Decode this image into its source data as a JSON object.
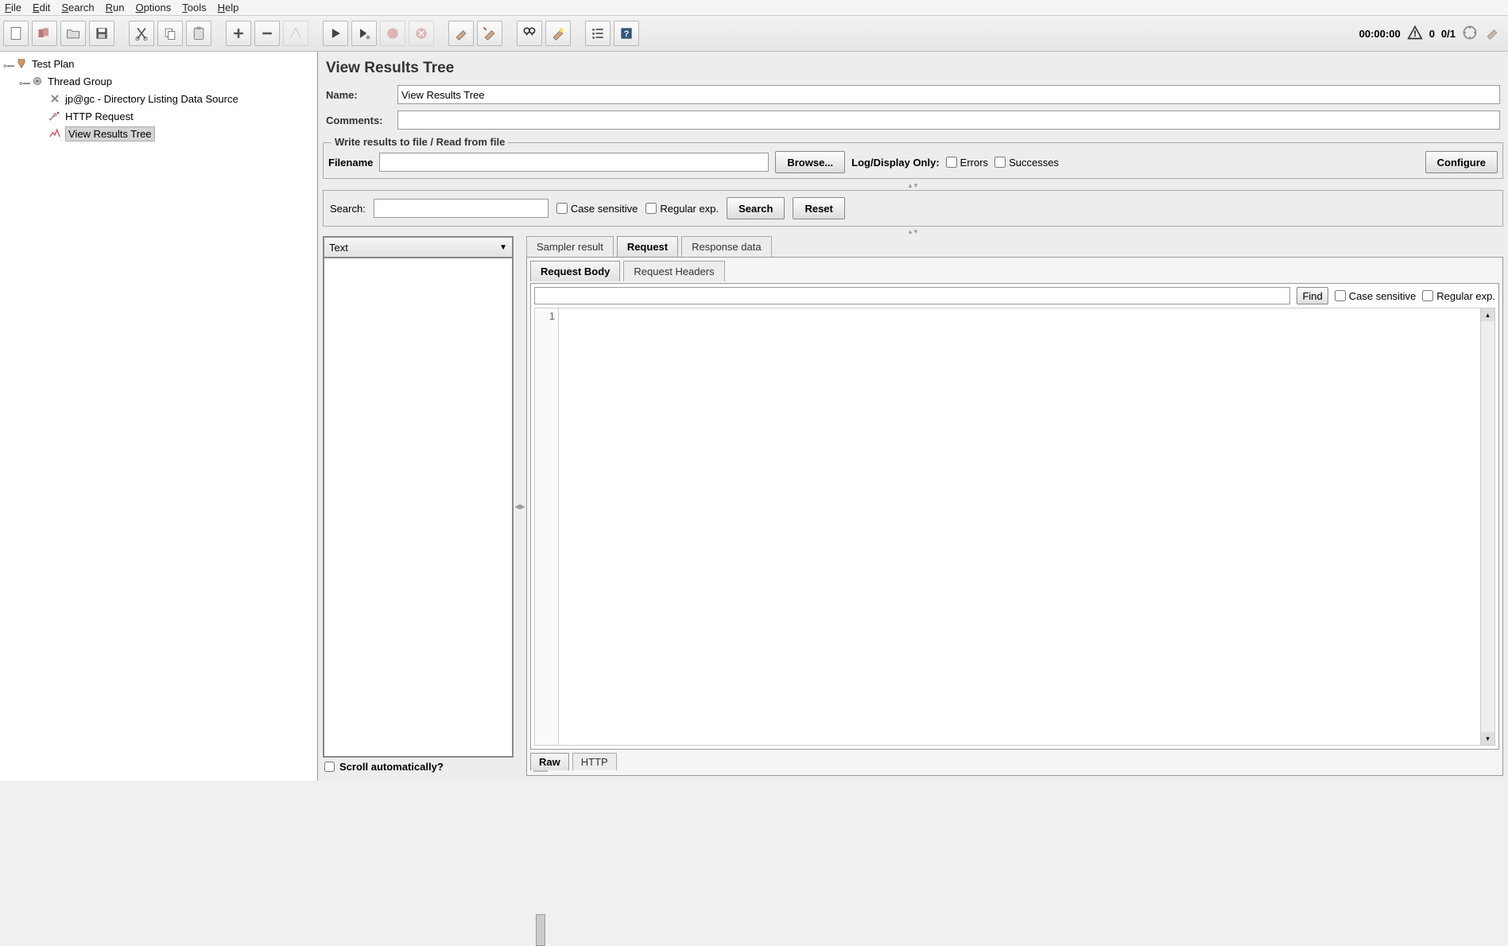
{
  "menu": [
    "File",
    "Edit",
    "Search",
    "Run",
    "Options",
    "Tools",
    "Help"
  ],
  "toolbar_right": {
    "time": "00:00:00",
    "warn": "0",
    "threads": "0/1"
  },
  "tree": {
    "root": "Test Plan",
    "group": "Thread Group",
    "items": [
      "jp@gc - Directory Listing Data Source",
      "HTTP Request",
      "View Results Tree"
    ],
    "selected_index": 2
  },
  "panel": {
    "title": "View Results Tree",
    "name_label": "Name:",
    "name_value": "View Results Tree",
    "comments_label": "Comments:",
    "comments_value": "",
    "file_legend": "Write results to file / Read from file",
    "filename_label": "Filename",
    "filename_value": "",
    "browse": "Browse...",
    "log_label": "Log/Display Only:",
    "errors": "Errors",
    "successes": "Successes",
    "configure": "Configure"
  },
  "searchbar": {
    "label": "Search:",
    "case": "Case sensitive",
    "regex": "Regular exp.",
    "search": "Search",
    "reset": "Reset"
  },
  "results": {
    "renderer": "Text",
    "scroll_auto": "Scroll automatically?",
    "tabs_outer": [
      "Sampler result",
      "Request",
      "Response data"
    ],
    "tabs_outer_active": 1,
    "tabs_inner": [
      "Request Body",
      "Request Headers"
    ],
    "tabs_inner_active": 0,
    "find": "Find",
    "case": "Case sensitive",
    "regex": "Regular exp.",
    "line_no": "1",
    "tabs_bottom": [
      "Raw",
      "HTTP"
    ],
    "tabs_bottom_active": 0
  }
}
